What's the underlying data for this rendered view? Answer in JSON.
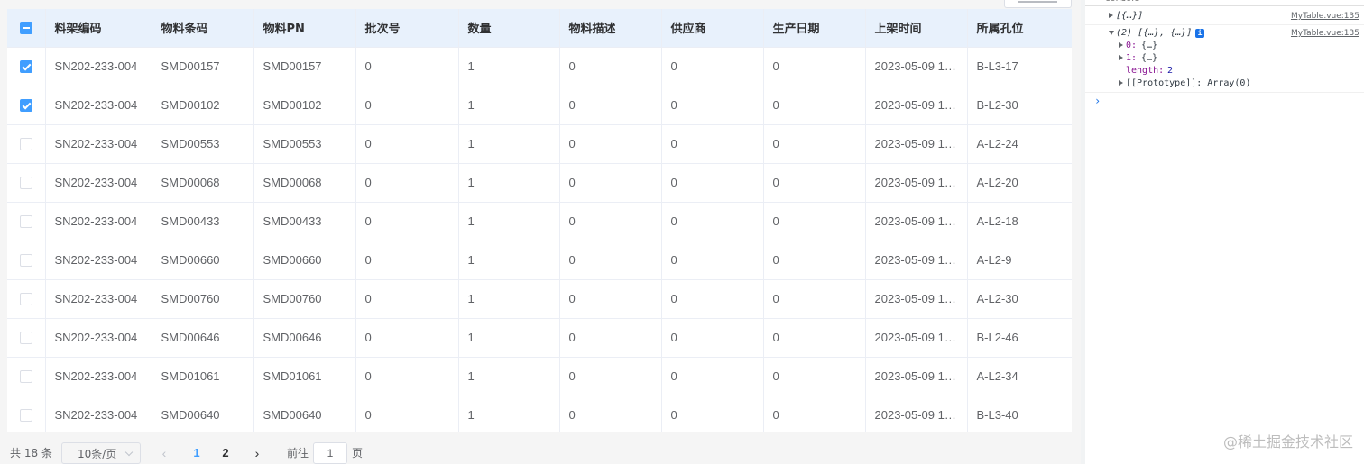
{
  "table": {
    "columns": [
      "料架编码",
      "物料条码",
      "物料PN",
      "批次号",
      "数量",
      "物料描述",
      "供应商",
      "生产日期",
      "上架时间",
      "所属孔位"
    ],
    "rows": [
      {
        "checked": true,
        "cells": [
          "SN202-233-004",
          "SMD00157",
          "SMD00157",
          "0",
          "1",
          "0",
          "0",
          "0",
          "2023-05-09 1…",
          "B-L3-17"
        ]
      },
      {
        "checked": true,
        "cells": [
          "SN202-233-004",
          "SMD00102",
          "SMD00102",
          "0",
          "1",
          "0",
          "0",
          "0",
          "2023-05-09 1…",
          "B-L2-30"
        ]
      },
      {
        "checked": false,
        "cells": [
          "SN202-233-004",
          "SMD00553",
          "SMD00553",
          "0",
          "1",
          "0",
          "0",
          "0",
          "2023-05-09 1…",
          "A-L2-24"
        ]
      },
      {
        "checked": false,
        "cells": [
          "SN202-233-004",
          "SMD00068",
          "SMD00068",
          "0",
          "1",
          "0",
          "0",
          "0",
          "2023-05-09 1…",
          "A-L2-20"
        ]
      },
      {
        "checked": false,
        "cells": [
          "SN202-233-004",
          "SMD00433",
          "SMD00433",
          "0",
          "1",
          "0",
          "0",
          "0",
          "2023-05-09 1…",
          "A-L2-18"
        ]
      },
      {
        "checked": false,
        "cells": [
          "SN202-233-004",
          "SMD00660",
          "SMD00660",
          "0",
          "1",
          "0",
          "0",
          "0",
          "2023-05-09 1…",
          "A-L2-9"
        ]
      },
      {
        "checked": false,
        "cells": [
          "SN202-233-004",
          "SMD00760",
          "SMD00760",
          "0",
          "1",
          "0",
          "0",
          "0",
          "2023-05-09 1…",
          "A-L2-30"
        ]
      },
      {
        "checked": false,
        "cells": [
          "SN202-233-004",
          "SMD00646",
          "SMD00646",
          "0",
          "1",
          "0",
          "0",
          "0",
          "2023-05-09 1…",
          "B-L2-46"
        ]
      },
      {
        "checked": false,
        "cells": [
          "SN202-233-004",
          "SMD01061",
          "SMD01061",
          "0",
          "1",
          "0",
          "0",
          "0",
          "2023-05-09 1…",
          "A-L2-34"
        ]
      },
      {
        "checked": false,
        "cells": [
          "SN202-233-004",
          "SMD00640",
          "SMD00640",
          "0",
          "1",
          "0",
          "0",
          "0",
          "2023-05-09 1…",
          "B-L3-40"
        ]
      }
    ]
  },
  "pagination": {
    "total": "共 18 条",
    "page_size": "10条/页",
    "pages": [
      "1",
      "2"
    ],
    "current_page": "1",
    "goto_label": "前往",
    "goto_value": "1",
    "goto_suffix": "页"
  },
  "console": {
    "header": "console",
    "line1_text": "[{…}]",
    "line1_src": "MyTable.vue:135",
    "line2_text": "(2) [{…}, {…}]",
    "line2_src": "MyTable.vue:135",
    "item0_key": "0:",
    "item0_val": "{…}",
    "item1_key": "1:",
    "item1_val": "{…}",
    "length_key": "length:",
    "length_val": "2",
    "proto_text": "[[Prototype]]: Array(0)",
    "prompt": "›"
  },
  "watermark": "@稀土掘金技术社区",
  "colors": {
    "accent": "#409eff",
    "header_bg": "#e8f1fc",
    "console_blue": "#1a73e8"
  }
}
